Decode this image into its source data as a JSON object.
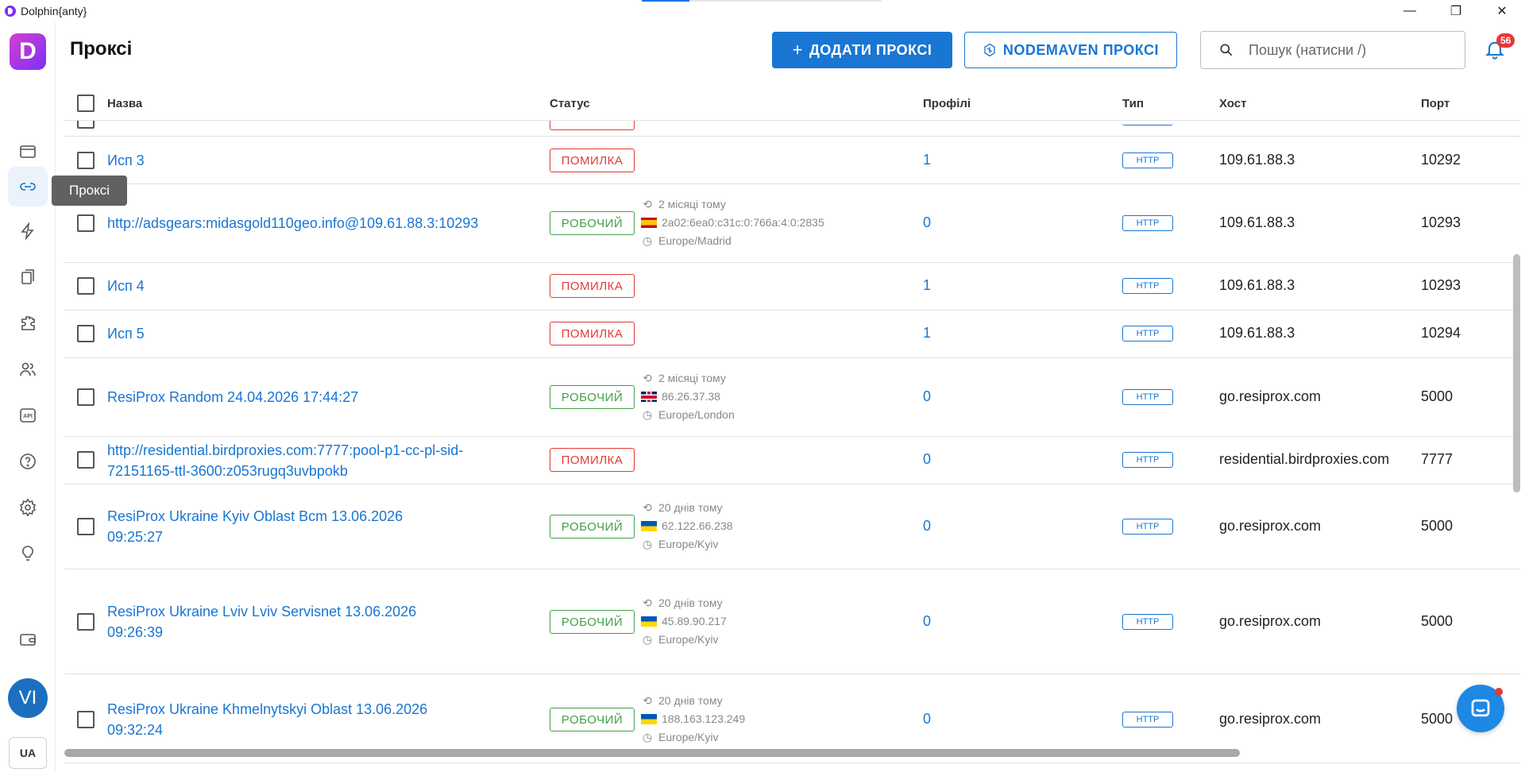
{
  "window": {
    "title": "Dolphin{anty}"
  },
  "sidebar": {
    "logo": "D",
    "tooltip": "Проксі",
    "avatar": "VI",
    "lang": "UA",
    "items": [
      {
        "icon": "browser-profiles-icon"
      },
      {
        "icon": "proxy-link-icon"
      },
      {
        "icon": "automation-icon"
      },
      {
        "icon": "bookmarks-icon"
      },
      {
        "icon": "extensions-icon"
      },
      {
        "icon": "team-icon"
      },
      {
        "icon": "api-icon"
      },
      {
        "icon": "help-icon"
      },
      {
        "icon": "settings-icon"
      },
      {
        "icon": "ideas-icon"
      },
      {
        "icon": "wallet-icon"
      }
    ]
  },
  "header": {
    "title": "Проксі",
    "add_button": "ДОДАТИ ПРОКСІ",
    "nodemaven_button": "NODEMAVEN ПРОКСІ",
    "search_placeholder": "Пошук (натисни /)",
    "notifications_count": "56"
  },
  "table": {
    "columns": {
      "name": "Назва",
      "status": "Статус",
      "profiles": "Профілі",
      "type": "Тип",
      "host": "Хост",
      "port": "Порт"
    },
    "rows": [
      {
        "name": "Исп 3",
        "status": "ПОМИЛКА",
        "kind": "err",
        "profiles": "1",
        "type": "HTTP",
        "host": "109.61.88.3",
        "port": "10292"
      },
      {
        "name": "http://adsgears:midasgold110geo.info@109.61.88.3:10293",
        "status": "РОБОЧИЙ",
        "kind": "ok",
        "checked": "2 місяці тому",
        "ip": "2a02:6ea0:c31c:0:766a:4:0:2835",
        "flag": "es",
        "tz": "Europe/Madrid",
        "profiles": "0",
        "type": "HTTP",
        "host": "109.61.88.3",
        "port": "10293"
      },
      {
        "name": "Исп 4",
        "status": "ПОМИЛКА",
        "kind": "err",
        "profiles": "1",
        "type": "HTTP",
        "host": "109.61.88.3",
        "port": "10293"
      },
      {
        "name": "Исп 5",
        "status": "ПОМИЛКА",
        "kind": "err",
        "profiles": "1",
        "type": "HTTP",
        "host": "109.61.88.3",
        "port": "10294"
      },
      {
        "name": "ResiProx Random 24.04.2026 17:44:27",
        "status": "РОБОЧИЙ",
        "kind": "ok",
        "checked": "2 місяці тому",
        "ip": "86.26.37.38",
        "flag": "gb",
        "tz": "Europe/London",
        "profiles": "0",
        "type": "HTTP",
        "host": "go.resiprox.com",
        "port": "5000"
      },
      {
        "name_line1": "http://residential.birdproxies.com:7777:pool-p1-cc-pl-sid-",
        "name_line2": "72151165-ttl-3600:z053rugq3uvbpokb",
        "status": "ПОМИЛКА",
        "kind": "err",
        "profiles": "0",
        "type": "HTTP",
        "host": "residential.birdproxies.com",
        "port": "7777"
      },
      {
        "name_line1": "ResiProx Ukraine Kyiv Oblast Bcm 13.06.2026",
        "name_line2": "09:25:27",
        "status": "РОБОЧИЙ",
        "kind": "ok",
        "checked": "20 днів тому",
        "ip": "62.122.66.238",
        "flag": "ua",
        "tz": "Europe/Kyiv",
        "profiles": "0",
        "type": "HTTP",
        "host": "go.resiprox.com",
        "port": "5000"
      },
      {
        "name_line1": "ResiProx Ukraine Lviv Lviv Servisnet 13.06.2026",
        "name_line2": "09:26:39",
        "status": "РОБОЧИЙ",
        "kind": "ok",
        "checked": "20 днів тому",
        "ip": "45.89.90.217",
        "flag": "ua",
        "tz": "Europe/Kyiv",
        "profiles": "0",
        "type": "HTTP",
        "host": "go.resiprox.com",
        "port": "5000"
      },
      {
        "name_line1": "ResiProx Ukraine Khmelnytskyi Oblast 13.06.2026",
        "name_line2": "09:32:24",
        "status": "РОБОЧИЙ",
        "kind": "ok",
        "checked": "20 днів тому",
        "ip": "188.163.123.249",
        "flag": "ua",
        "tz": "Europe/Kyiv",
        "profiles": "0",
        "type": "HTTP",
        "host": "go.resiprox.com",
        "port": "5000"
      }
    ]
  }
}
